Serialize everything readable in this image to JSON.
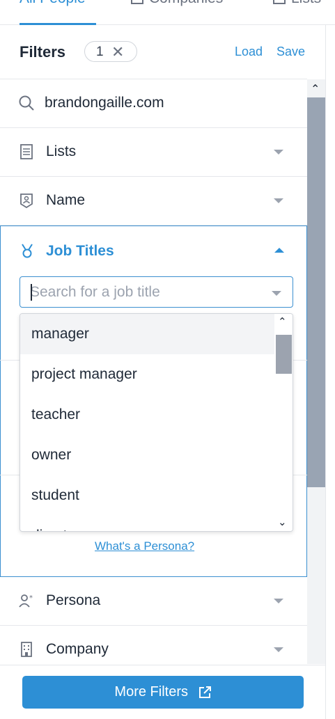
{
  "tabs": [
    {
      "label": "All People",
      "active": true
    },
    {
      "label": "Companies",
      "active": false
    },
    {
      "label": "Lists",
      "active": false
    }
  ],
  "filters": {
    "title": "Filters",
    "count": "1",
    "load_label": "Load",
    "save_label": "Save"
  },
  "rows": {
    "keyword": "brandongaille.com",
    "lists": "Lists",
    "name": "Name",
    "job_titles": "Job Titles",
    "persona": "Persona",
    "company": "Company"
  },
  "job_title_search": {
    "placeholder": "Search for a job title",
    "value": ""
  },
  "job_title_options": [
    "manager",
    "project manager",
    "teacher",
    "owner",
    "student",
    "director"
  ],
  "persona_link": "What's a Persona?",
  "more_filters_label": "More Filters",
  "colors": {
    "accent": "#2d8fd5",
    "scrollbar": "#99a4b3",
    "border": "#e5e7eb"
  }
}
